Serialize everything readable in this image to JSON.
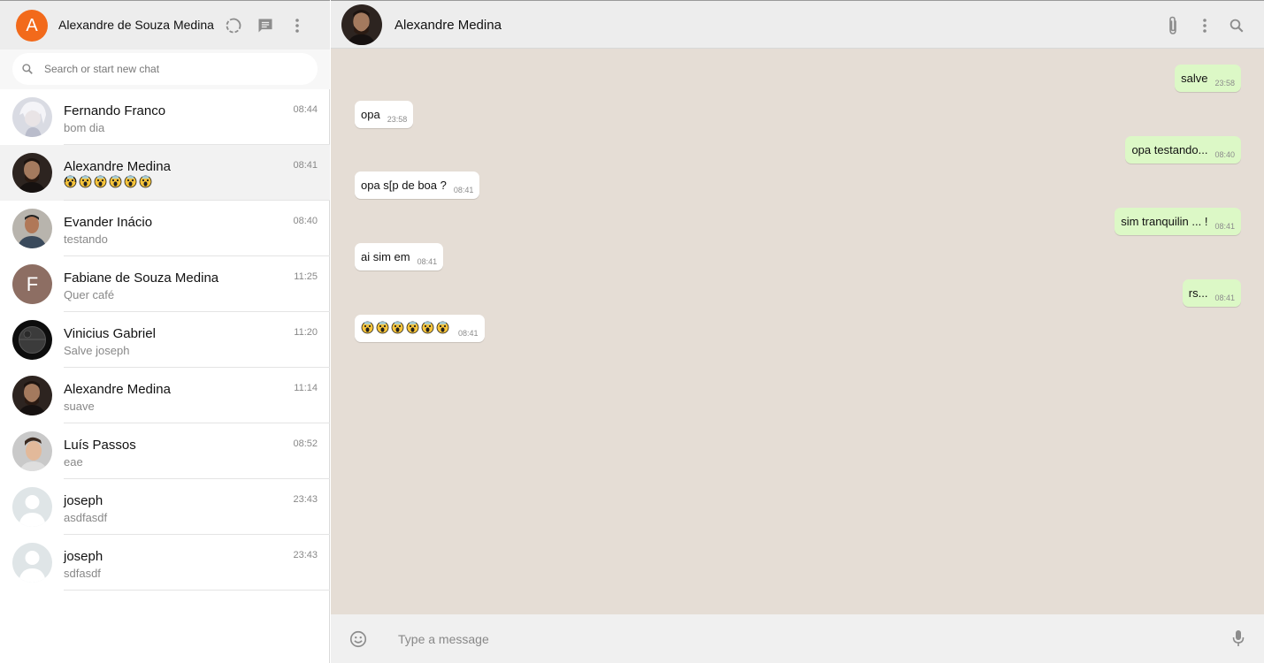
{
  "me": {
    "initial": "A",
    "name": "Alexandre de Souza Medina",
    "avatar_color": "#f26a1b"
  },
  "header_icons": [
    "status-icon",
    "new-chat-icon",
    "menu-icon"
  ],
  "search": {
    "placeholder": "Search or start new chat"
  },
  "chats": [
    {
      "name": "Fernando Franco",
      "last": "bom dia",
      "time": "08:44"
    },
    {
      "name": "Alexandre Medina",
      "last": "😱😱😱😱😱😱",
      "time": "08:41",
      "active": true
    },
    {
      "name": "Evander Inácio",
      "last": "testando",
      "time": "08:40"
    },
    {
      "name": "Fabiane de Souza Medina",
      "last": "Quer café",
      "time": "11:25",
      "initial": "F"
    },
    {
      "name": "Vinicius Gabriel",
      "last": "Salve joseph",
      "time": "11:20"
    },
    {
      "name": "Alexandre Medina",
      "last": "suave",
      "time": "11:14"
    },
    {
      "name": "Luís Passos",
      "last": "eae",
      "time": "08:52"
    },
    {
      "name": "joseph",
      "last": "asdfasdf",
      "time": "23:43"
    },
    {
      "name": "joseph",
      "last": "sdfasdf",
      "time": "23:43"
    }
  ],
  "conversation": {
    "contact_name": "Alexandre Medina",
    "messages": [
      {
        "dir": "out",
        "text": "salve",
        "time": "23:58"
      },
      {
        "dir": "in",
        "text": "opa",
        "time": "23:58"
      },
      {
        "dir": "out",
        "text": "opa testando...",
        "time": "08:40"
      },
      {
        "dir": "in",
        "text": "opa s[p de boa ?",
        "time": "08:41"
      },
      {
        "dir": "out",
        "text": "sim tranquilin ... !",
        "time": "08:41"
      },
      {
        "dir": "in",
        "text": "ai sim em",
        "time": "08:41"
      },
      {
        "dir": "out",
        "text": "rs...",
        "time": "08:41"
      },
      {
        "dir": "in",
        "text": "😱😱😱😱😱😱",
        "time": "08:41"
      }
    ]
  },
  "composer": {
    "placeholder": "Type a message"
  },
  "colors": {
    "outgoing_bubble": "#dcf8c6",
    "incoming_bubble": "#ffffff",
    "chat_background": "#e5ddd5",
    "header": "#ededed"
  }
}
